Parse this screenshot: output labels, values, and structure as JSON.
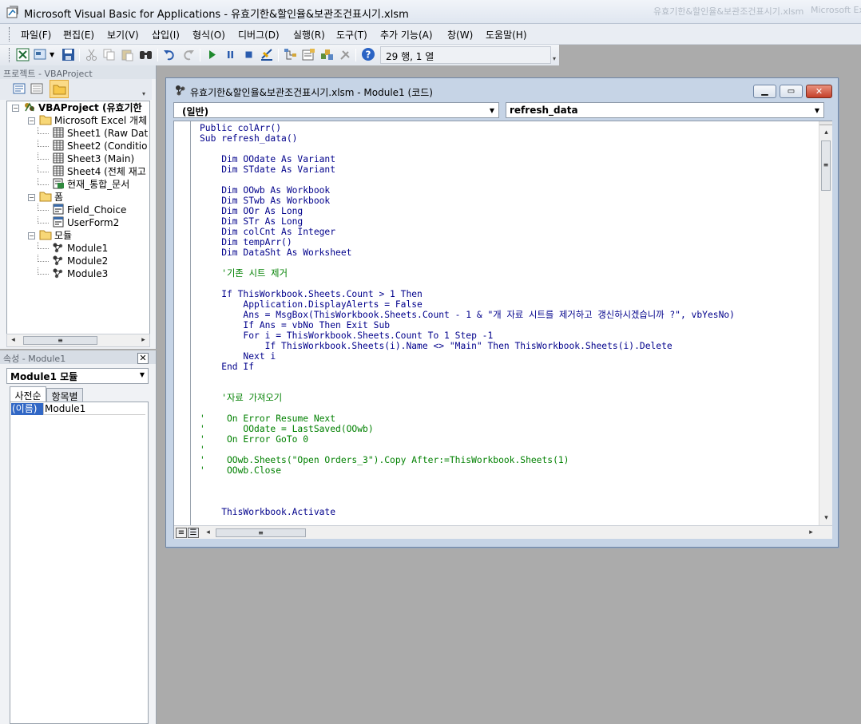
{
  "window": {
    "title": "Microsoft Visual Basic for Applications - 유효기한&할인율&보관조건표시기.xlsm",
    "ghost_text_1": "유효기한&할인율&보관조건표시기.xlsm",
    "ghost_text_2": "Microsoft Excel"
  },
  "menu": [
    "파일(F)",
    "편집(E)",
    "보기(V)",
    "삽입(I)",
    "형식(O)",
    "디버그(D)",
    "실행(R)",
    "도구(T)",
    "추가 기능(A)",
    "창(W)",
    "도움말(H)"
  ],
  "toolbar": {
    "position": "29 행, 1 열",
    "icons": [
      "excel-view-icon",
      "insert-object-icon",
      "save-icon",
      "cut-icon",
      "copy-icon",
      "paste-icon",
      "find-icon",
      "undo-icon",
      "redo-icon",
      "run-icon",
      "break-icon",
      "reset-icon",
      "design-mode-icon",
      "project-explorer-icon",
      "properties-icon",
      "object-browser-icon",
      "toolbox-icon",
      "help-icon"
    ]
  },
  "project_pane": {
    "title": "프로젝트 - VBAProject",
    "tree": [
      {
        "label": "VBAProject (유효기한",
        "level": 0,
        "expander": "−",
        "icon": "vba-project-icon",
        "bold": true
      },
      {
        "label": "Microsoft Excel 개체",
        "level": 1,
        "expander": "−",
        "icon": "folder-icon"
      },
      {
        "label": "Sheet1 (Raw Dat",
        "level": 2,
        "icon": "sheet-icon"
      },
      {
        "label": "Sheet2 (Conditio",
        "level": 2,
        "icon": "sheet-icon"
      },
      {
        "label": "Sheet3 (Main)",
        "level": 2,
        "icon": "sheet-icon"
      },
      {
        "label": "Sheet4 (전체 재고",
        "level": 2,
        "icon": "sheet-icon"
      },
      {
        "label": "현재_통합_문서",
        "level": 2,
        "icon": "workbook-icon"
      },
      {
        "label": "폼",
        "level": 1,
        "expander": "−",
        "icon": "folder-icon"
      },
      {
        "label": "Field_Choice",
        "level": 2,
        "icon": "form-icon"
      },
      {
        "label": "UserForm2",
        "level": 2,
        "icon": "form-icon"
      },
      {
        "label": "모듈",
        "level": 1,
        "expander": "−",
        "icon": "folder-icon"
      },
      {
        "label": "Module1",
        "level": 2,
        "icon": "module-icon"
      },
      {
        "label": "Module2",
        "level": 2,
        "icon": "module-icon"
      },
      {
        "label": "Module3",
        "level": 2,
        "icon": "module-icon"
      }
    ]
  },
  "properties_pane": {
    "title": "속성 - Module1",
    "object": "Module1 모듈",
    "tabs": [
      "사전순",
      "항목별"
    ],
    "rows": [
      {
        "name": "(이름)",
        "value": "Module1"
      }
    ]
  },
  "code_window": {
    "title": "유효기한&할인율&보관조건표시기.xlsm - Module1 (코드)",
    "object_dropdown": "(일반)",
    "proc_dropdown": "refresh_data",
    "lines": [
      {
        "t": "Public colArr()",
        "c": "kw"
      },
      {
        "t": "Sub refresh_data()",
        "c": "kw"
      },
      {
        "t": "",
        "c": "kw"
      },
      {
        "t": "    Dim OOdate As Variant",
        "c": "kw"
      },
      {
        "t": "    Dim STdate As Variant",
        "c": "kw"
      },
      {
        "t": "",
        "c": "kw"
      },
      {
        "t": "    Dim OOwb As Workbook",
        "c": "kw"
      },
      {
        "t": "    Dim STwb As Workbook",
        "c": "kw"
      },
      {
        "t": "    Dim OOr As Long",
        "c": "kw"
      },
      {
        "t": "    Dim STr As Long",
        "c": "kw"
      },
      {
        "t": "    Dim colCnt As Integer",
        "c": "kw"
      },
      {
        "t": "    Dim tempArr()",
        "c": "kw"
      },
      {
        "t": "    Dim DataSht As Worksheet",
        "c": "kw"
      },
      {
        "t": "",
        "c": "kw"
      },
      {
        "t": "    '기존 시트 제거",
        "c": "cm"
      },
      {
        "t": "",
        "c": "kw"
      },
      {
        "t": "    If ThisWorkbook.Sheets.Count > 1 Then",
        "c": "kw"
      },
      {
        "t": "        Application.DisplayAlerts = False",
        "c": "kw"
      },
      {
        "t": "        Ans = MsgBox(ThisWorkbook.Sheets.Count - 1 & \"개 자료 시트를 제거하고 갱신하시겠습니까 ?\", vbYesNo)",
        "c": "kw"
      },
      {
        "t": "        If Ans = vbNo Then Exit Sub",
        "c": "kw"
      },
      {
        "t": "        For i = ThisWorkbook.Sheets.Count To 1 Step -1",
        "c": "kw"
      },
      {
        "t": "            If ThisWorkbook.Sheets(i).Name <> \"Main\" Then ThisWorkbook.Sheets(i).Delete",
        "c": "kw"
      },
      {
        "t": "        Next i",
        "c": "kw"
      },
      {
        "t": "    End If",
        "c": "kw"
      },
      {
        "t": "",
        "c": "kw"
      },
      {
        "t": "",
        "c": "kw"
      },
      {
        "t": "    '자료 가져오기",
        "c": "cm"
      },
      {
        "t": "",
        "c": "kw"
      },
      {
        "t": "'    On Error Resume Next",
        "c": "cm"
      },
      {
        "t": "'       OOdate = LastSaved(OOwb)",
        "c": "cm"
      },
      {
        "t": "'    On Error GoTo 0",
        "c": "cm"
      },
      {
        "t": "'",
        "c": "cm"
      },
      {
        "t": "'    OOwb.Sheets(\"Open Orders_3\").Copy After:=ThisWorkbook.Sheets(1)",
        "c": "cm"
      },
      {
        "t": "'    OOwb.Close",
        "c": "cm"
      },
      {
        "t": "",
        "c": "kw"
      },
      {
        "t": "",
        "c": "kw"
      },
      {
        "t": "",
        "c": "kw"
      },
      {
        "t": "    ThisWorkbook.Activate",
        "c": "kw"
      }
    ]
  }
}
